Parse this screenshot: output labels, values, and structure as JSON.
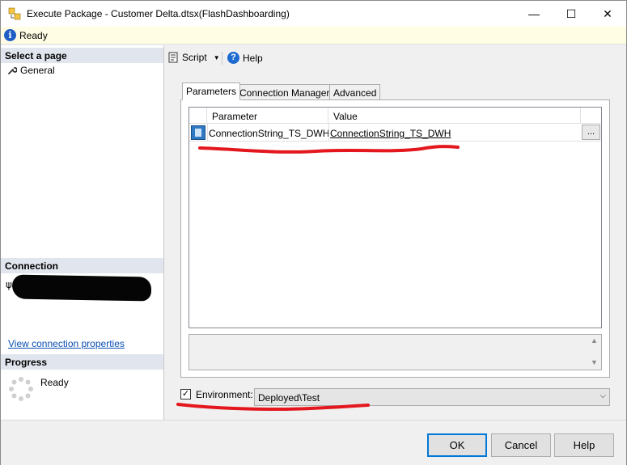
{
  "window": {
    "title": "Execute Package - Customer Delta.dtsx(FlashDashboarding)",
    "minimize": "—",
    "maximize": "☐",
    "close": "✕"
  },
  "status": {
    "text": "Ready",
    "icon": "info-icon"
  },
  "left": {
    "select_page": "Select a page",
    "pages": [
      {
        "label": "General",
        "icon": "wrench-icon"
      }
    ],
    "connection_header": "Connection",
    "view_connection": "View connection properties",
    "progress_header": "Progress",
    "progress_text": "Ready"
  },
  "toolbar": {
    "script": "Script",
    "help": "Help"
  },
  "tabs": [
    {
      "label": "Parameters"
    },
    {
      "label": "Connection Managers"
    },
    {
      "label": "Advanced"
    }
  ],
  "grid": {
    "columns": [
      "Parameter",
      "Value"
    ],
    "rows": [
      {
        "parameter": "ConnectionString_TS_DWH",
        "value": "ConnectionString_TS_DWH",
        "button": "..."
      }
    ]
  },
  "environment": {
    "label": "Environment:",
    "checked": true,
    "value": "Deployed\\Test"
  },
  "buttons": {
    "ok": "OK",
    "cancel": "Cancel",
    "help": "Help"
  },
  "colors": {
    "accent": "#0078d7",
    "annotation": "#e3171d",
    "section_header": "#e1e6ee"
  }
}
